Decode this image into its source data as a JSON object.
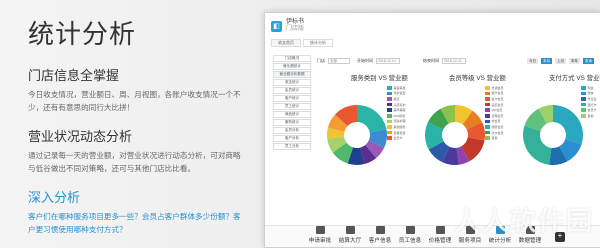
{
  "hero": {
    "title": "统计分析"
  },
  "sections": [
    {
      "title": "门店信息全掌握",
      "body": "今日收支情况，营业额日、周、月视图，各账户收支情况一个不少，还有有意思的同行大比拼！"
    },
    {
      "title": "营业状况动态分析",
      "body": "通过记录每一天的营业额，对营业状况进行动态分析，可对商略与低谷做出不同对策略，还可与其他门店比比看。"
    },
    {
      "title": "深入分析",
      "body": "客户们在哪种服务项目更多一些？会员占客户群体多少份额？客户更习惯使用哪种支付方式？"
    }
  ],
  "app": {
    "logo_text": "伊标书",
    "logo_sub": "门店版",
    "tabs": [
      "收支首页",
      "统计分析"
    ],
    "sidebar": [
      "门店概况",
      "营业额统计",
      "营业额分析数据",
      "收支统计",
      "会员统计",
      "客户统计",
      "员工统计",
      "商品统计",
      "服务统计",
      "会员分析",
      "客户分析",
      "员工分析"
    ],
    "filters": {
      "store_label": "门店",
      "store_value": "全部",
      "start_label": "开始时间",
      "start_value": "2016-12-01",
      "end_label": "结束时间",
      "end_value": "2016-12-31",
      "btns": [
        "今日",
        "本月",
        "上月",
        "本年",
        "查询"
      ]
    },
    "charts": [
      {
        "title": "服务类别 VS 营业额",
        "legend": [
          "美容美发",
          "洗护造型",
          "染烫",
          "头皮养护",
          "美甲美睫",
          "SPA按摩",
          "皮肤护理",
          "其他服务",
          "套餐项目",
          "会员卡"
        ]
      },
      {
        "title": "会员等级 VS 营业额",
        "legend": [
          "普通会员",
          "银卡会员",
          "金卡会员",
          "钻石会员",
          "VIP会员",
          "至尊会员",
          "非会员",
          "储值会员",
          "次卡会员",
          "其他"
        ]
      },
      {
        "title": "支付方式 VS 营业额",
        "legend": [
          "现金",
          "微信",
          "支付宝",
          "银行卡",
          "会员卡",
          "其他"
        ]
      }
    ],
    "toolbar": [
      "申请审批",
      "结算大厅",
      "客户信息",
      "员工信息",
      "价格管理",
      "服务项目",
      "统计分析",
      "数据管理"
    ]
  },
  "watermark": "人人软件园",
  "colors": {
    "accent": "#2a8fd0",
    "pie1": [
      "#2ab3a6",
      "#3b8bd1",
      "#9b59b6",
      "#5b2d8e",
      "#1f3f8f",
      "#4fb96a",
      "#a7d26a",
      "#f1c232",
      "#f39c34",
      "#e8572f"
    ],
    "pie2": [
      "#f1c232",
      "#e67e22",
      "#e8572f",
      "#c0392b",
      "#8e44ad",
      "#4a3a9e",
      "#2d5aa8",
      "#2ab3a6",
      "#3fa34d",
      "#8bc34a"
    ],
    "pie3": [
      "#2aa8c0",
      "#2a8fd0",
      "#1f6fae",
      "#34b09b",
      "#5fc17a",
      "#9bd06b"
    ]
  }
}
